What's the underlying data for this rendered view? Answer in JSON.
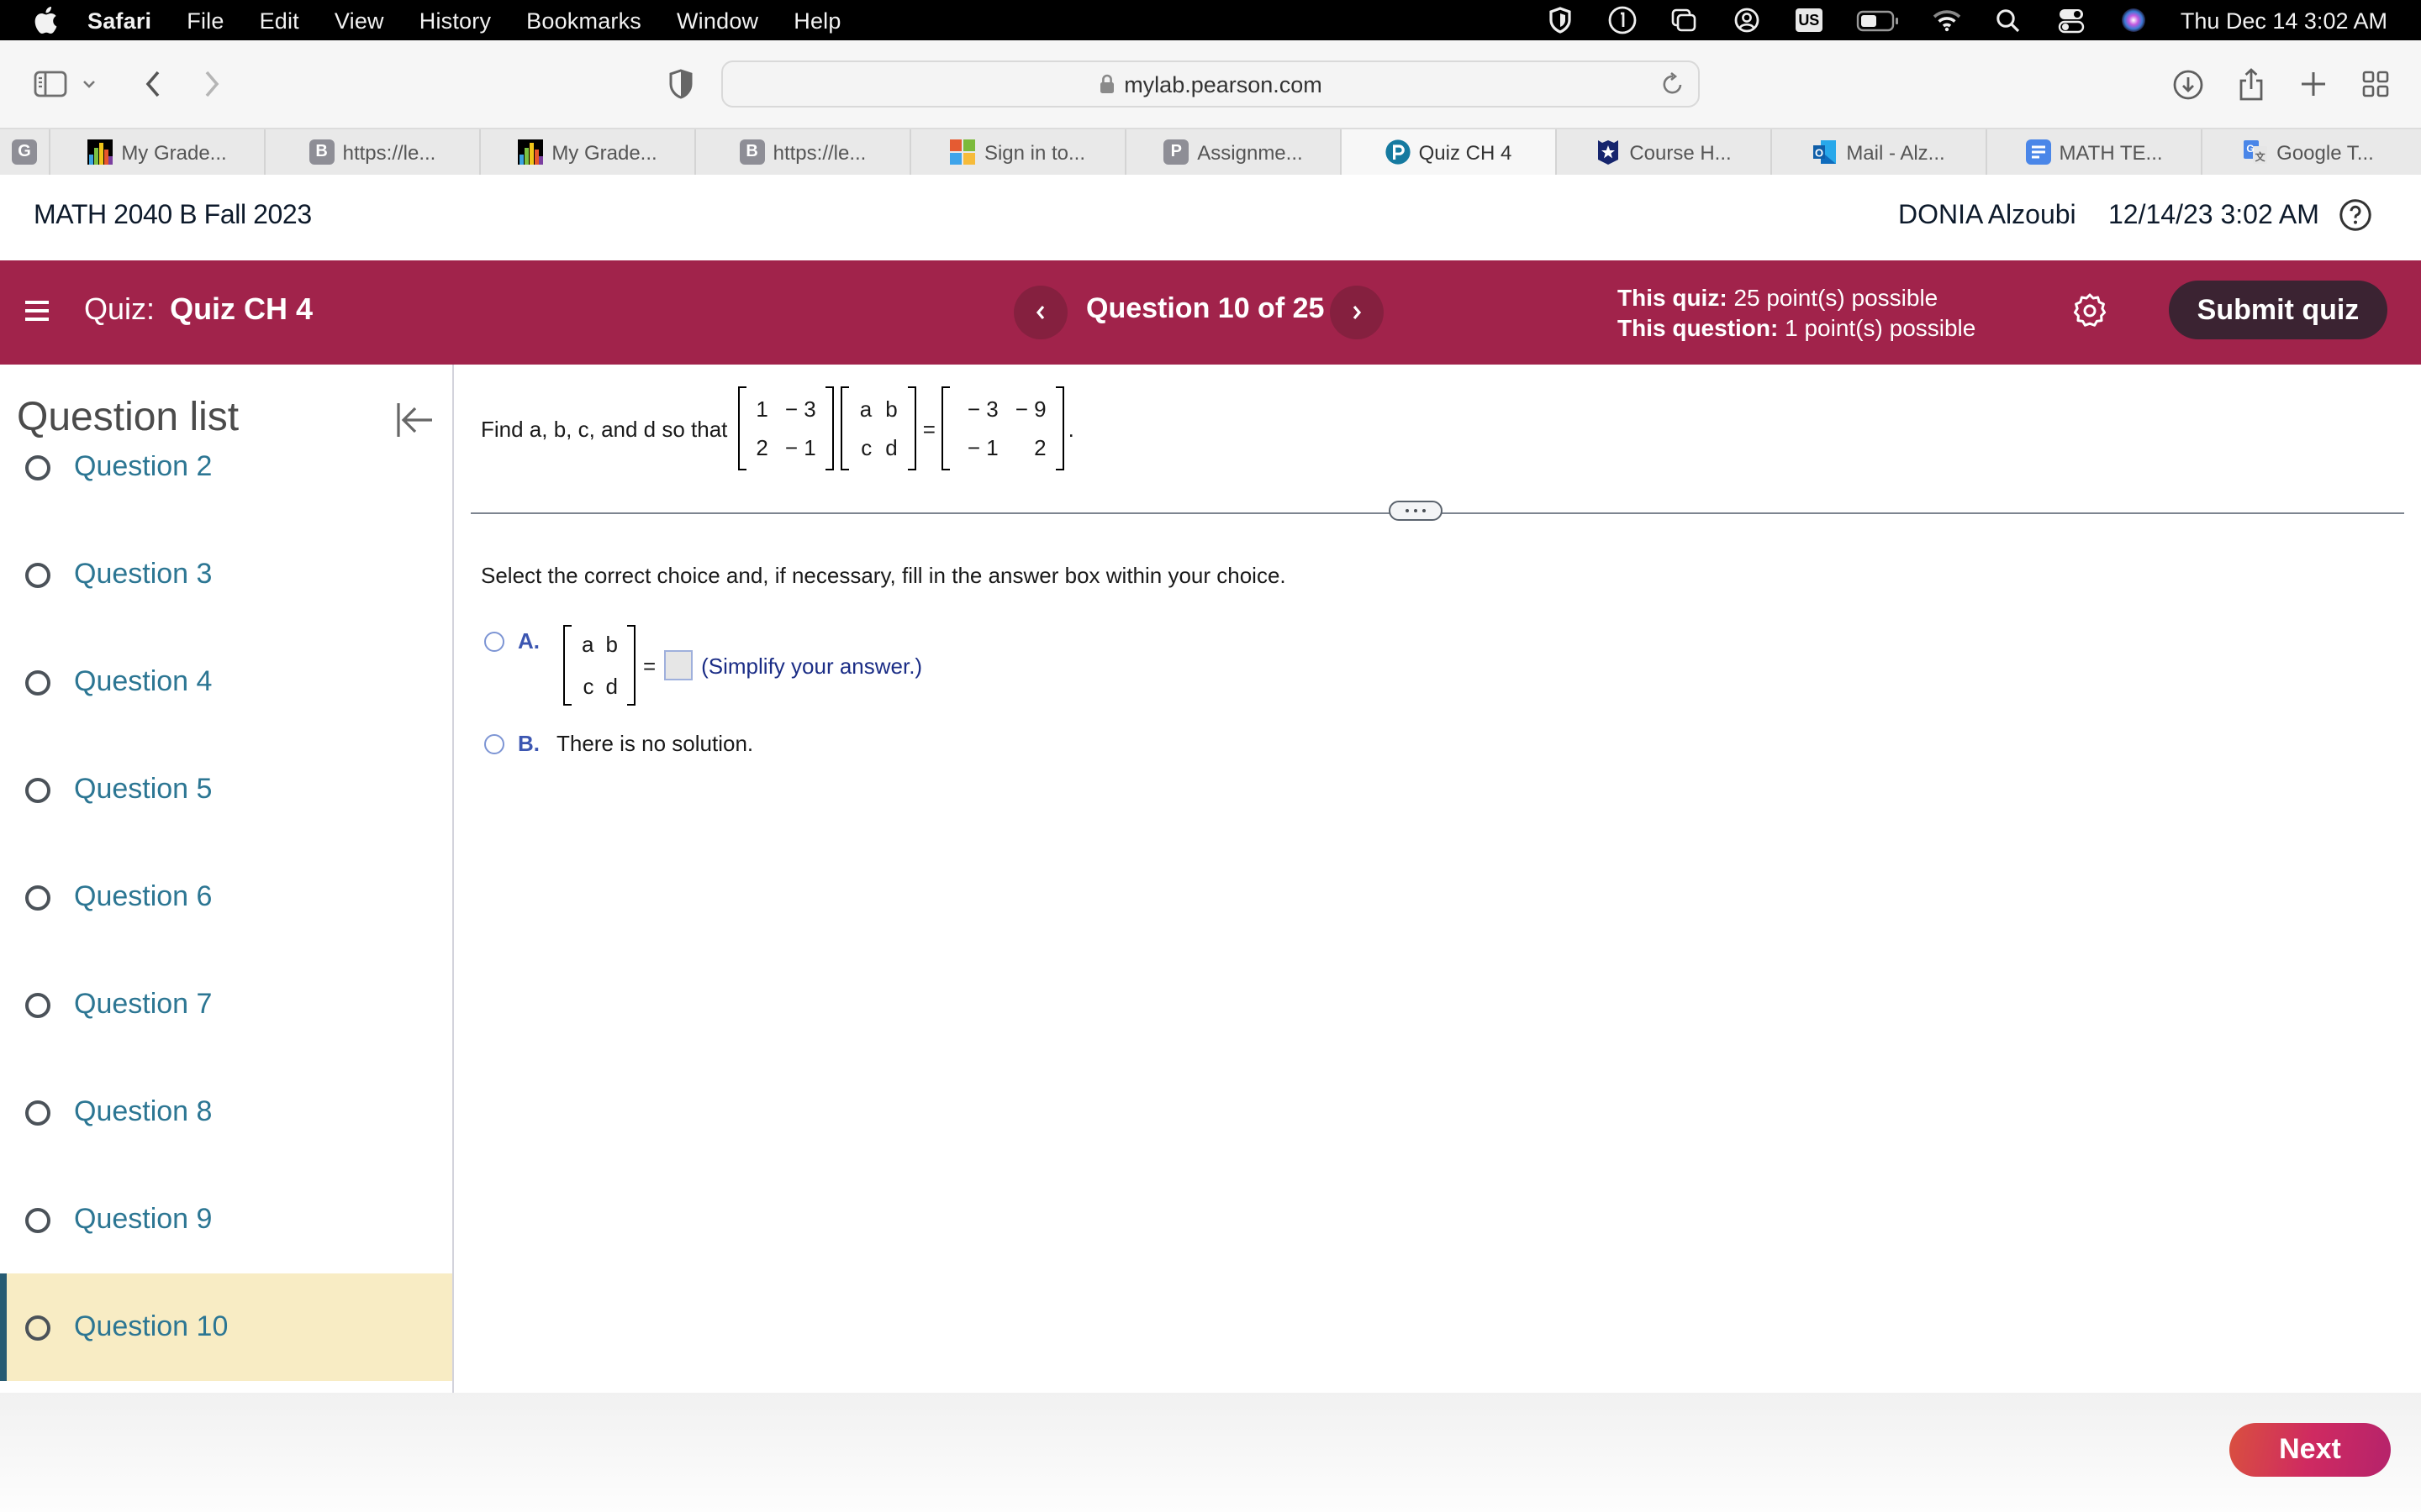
{
  "menubar": {
    "app_name": "Safari",
    "items": [
      "File",
      "Edit",
      "View",
      "History",
      "Bookmarks",
      "Window",
      "Help"
    ],
    "status_icons": [
      "vpn-shield-icon",
      "one-password-icon",
      "screen-mirroring-icon",
      "user-account-icon",
      "input-source-icon",
      "battery-icon",
      "wifi-icon",
      "spotlight-search-icon",
      "control-center-icon",
      "siri-icon"
    ],
    "input_source": "US",
    "clock": "Thu Dec 14  3:02 AM"
  },
  "browser": {
    "url": "mylab.pearson.com",
    "tabs": [
      {
        "label": "",
        "icon": "G",
        "pinned": true,
        "color": "#8e8e96"
      },
      {
        "label": "My Grade...",
        "icon": "bar-chart-favicon",
        "pinned": false
      },
      {
        "label": "https://le...",
        "icon": "B",
        "pinned": false,
        "color": "#8e8e96"
      },
      {
        "label": "My Grade...",
        "icon": "bar-chart-favicon",
        "pinned": false
      },
      {
        "label": "https://le...",
        "icon": "B",
        "pinned": false,
        "color": "#8e8e96"
      },
      {
        "label": "Sign in to...",
        "icon": "microsoft-favicon",
        "pinned": false
      },
      {
        "label": "Assignme...",
        "icon": "P",
        "pinned": false,
        "color": "#8e8e96"
      },
      {
        "label": "Quiz CH 4",
        "icon": "pearson-favicon",
        "pinned": false,
        "active": true
      },
      {
        "label": "Course H...",
        "icon": "star-shield-favicon",
        "pinned": false
      },
      {
        "label": "Mail - Alz...",
        "icon": "outlook-favicon",
        "pinned": false
      },
      {
        "label": "MATH TE...",
        "icon": "google-docs-favicon",
        "pinned": false
      },
      {
        "label": "Google T...",
        "icon": "google-translate-favicon",
        "pinned": false
      }
    ]
  },
  "header": {
    "course_title": "MATH 2040 B Fall 2023",
    "user_name": "DONIA Alzoubi",
    "date_time": "12/14/23 3:02 AM"
  },
  "quizbar": {
    "quiz_prefix": "Quiz:",
    "quiz_name": "Quiz CH 4",
    "question_counter": "Question 10 of 25",
    "quiz_points_label": "This quiz:",
    "quiz_points_value": "25 point(s) possible",
    "question_points_label": "This question:",
    "question_points_value": "1 point(s) possible",
    "submit_label": "Submit quiz",
    "accent_color": "#a1234b"
  },
  "sidebar": {
    "title": "Question list",
    "items": [
      {
        "label": "Question 2"
      },
      {
        "label": "Question 3"
      },
      {
        "label": "Question 4"
      },
      {
        "label": "Question 5"
      },
      {
        "label": "Question 6"
      },
      {
        "label": "Question 7"
      },
      {
        "label": "Question 8"
      },
      {
        "label": "Question 9"
      },
      {
        "label": "Question 10",
        "current": true
      }
    ]
  },
  "question": {
    "prompt": "Find a, b, c, and d so that",
    "matrix_a": [
      "1",
      "− 3",
      "2",
      "− 1"
    ],
    "matrix_x": [
      "a",
      "b",
      "c",
      "d"
    ],
    "matrix_b": [
      "− 3",
      "− 9",
      "− 1",
      "2"
    ],
    "equals": "=",
    "period": ".",
    "instruction": "Select the correct choice and, if necessary, fill in the answer box within your choice.",
    "choices": [
      {
        "letter": "A.",
        "matrix": [
          "a",
          "b",
          "c",
          "d"
        ],
        "equals": "=",
        "answer_value": "",
        "hint": "(Simplify your answer.)"
      },
      {
        "letter": "B.",
        "text": "There is no solution."
      }
    ]
  },
  "footer": {
    "next_label": "Next"
  }
}
